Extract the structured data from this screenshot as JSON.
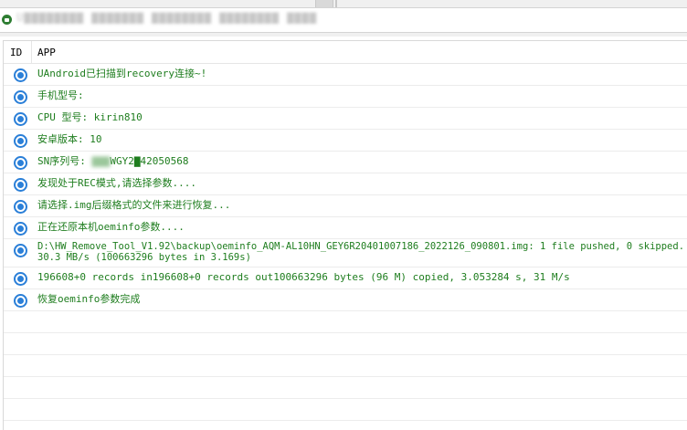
{
  "path_field": {
    "text": "U▇▇▇▇▇▇▇▇ ▇▇▇▇▇▇▇ ▇▇▇▇▇▇▇▇ ▇▇▇▇▇▇▇▇ ▇▇▇▇"
  },
  "table": {
    "columns": [
      "ID",
      "APP"
    ],
    "rows": [
      {
        "text": "UAndroid已扫描到recovery连接~!"
      },
      {
        "text": "手机型号:"
      },
      {
        "text": "CPU 型号: kirin810"
      },
      {
        "text": "安卓版本: 10"
      },
      {
        "text_prefix": "SN序列号: ",
        "text_hidden": "▇▇▇",
        "text_suffix": "WGY2▇42050568"
      },
      {
        "text": "发现处于REC模式,请选择参数...."
      },
      {
        "text": "请选择.img后缀格式的文件来进行恢复..."
      },
      {
        "text": "正在还原本机oeminfo参数...."
      },
      {
        "text": "D:\\HW_Remove_Tool_V1.92\\backup\\oeminfo_AQM-AL10HN_GEY6R20401007186_2022126_090801.img: 1 file pushed, 0 skipped.\n30.3 MB/s (100663296 bytes in 3.169s)"
      },
      {
        "text": "196608+0 records in196608+0 records out100663296 bytes (96 M) copied, 3.053284 s, 31 M/s"
      },
      {
        "text": "恢复oeminfo参数完成"
      },
      {
        "text": ""
      },
      {
        "text": ""
      },
      {
        "text": ""
      },
      {
        "text": ""
      },
      {
        "text": ""
      }
    ]
  },
  "colors": {
    "message_text": "#1e7d1e",
    "status_dot": "#2a7fd8"
  }
}
